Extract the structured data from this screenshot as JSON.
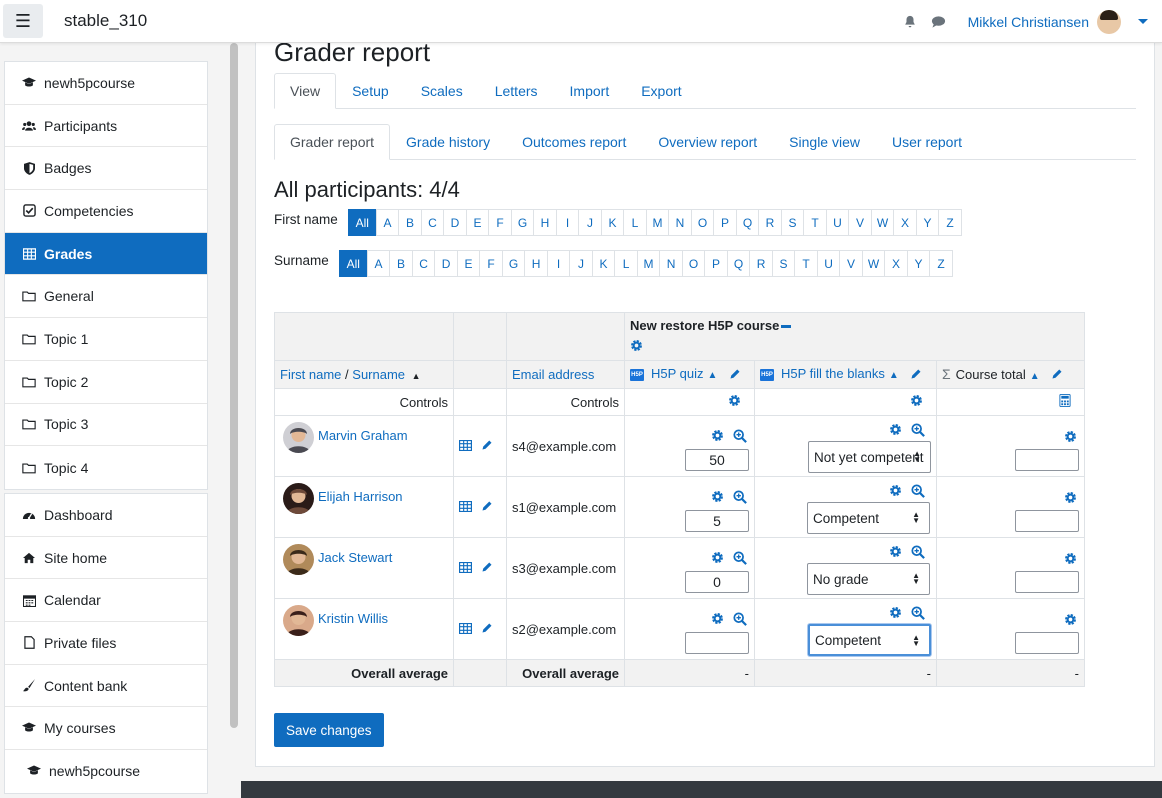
{
  "navbar": {
    "site_name": "stable_310",
    "user_name": "Mikkel Christiansen"
  },
  "sidebar": {
    "course_items": [
      {
        "label": "newh5pcourse",
        "icon": "graduation-cap-icon"
      },
      {
        "label": "Participants",
        "icon": "users-icon"
      },
      {
        "label": "Badges",
        "icon": "shield-icon"
      },
      {
        "label": "Competencies",
        "icon": "check-square-icon"
      },
      {
        "label": "Grades",
        "icon": "table-icon"
      },
      {
        "label": "General",
        "icon": "folder-icon"
      },
      {
        "label": "Topic 1",
        "icon": "folder-icon"
      },
      {
        "label": "Topic 2",
        "icon": "folder-icon"
      },
      {
        "label": "Topic 3",
        "icon": "folder-icon"
      },
      {
        "label": "Topic 4",
        "icon": "folder-icon"
      }
    ],
    "site_items": [
      {
        "label": "Dashboard",
        "icon": "tachometer-icon"
      },
      {
        "label": "Site home",
        "icon": "home-icon"
      },
      {
        "label": "Calendar",
        "icon": "calendar-icon"
      },
      {
        "label": "Private files",
        "icon": "file-icon"
      },
      {
        "label": "Content bank",
        "icon": "paint-brush-icon"
      },
      {
        "label": "My courses",
        "icon": "graduation-cap-icon"
      },
      {
        "label": "newh5pcourse",
        "icon": "graduation-cap-icon"
      }
    ]
  },
  "main": {
    "page_title": "Grader report",
    "tabs_top": [
      "View",
      "Setup",
      "Scales",
      "Letters",
      "Import",
      "Export"
    ],
    "tabs_sub": [
      "Grader report",
      "Grade history",
      "Outcomes report",
      "Overview report",
      "Single view",
      "User report"
    ],
    "participants_title": "All participants: 4/4",
    "first_name_label": "First name",
    "surname_label": "Surname",
    "all_label": "All",
    "letters": [
      "A",
      "B",
      "C",
      "D",
      "E",
      "F",
      "G",
      "H",
      "I",
      "J",
      "K",
      "L",
      "M",
      "N",
      "O",
      "P",
      "Q",
      "R",
      "S",
      "T",
      "U",
      "V",
      "W",
      "X",
      "Y",
      "Z"
    ],
    "save_label": "Save changes"
  },
  "table": {
    "category": "New restore H5P course",
    "col_firstname": "First name",
    "col_sep": "/",
    "col_surname": "Surname",
    "col_email": "Email address",
    "col_quiz": "H5P quiz",
    "col_blanks": "H5P fill the blanks",
    "col_total": "Course total",
    "h5p_badge": "H5P",
    "controls": "Controls",
    "overall_average": "Overall average",
    "avg_dash": "-",
    "rows": [
      {
        "name": "Marvin Graham",
        "email": "s4@example.com",
        "quiz": "50",
        "blanks": "Not yet competent",
        "total": ""
      },
      {
        "name": "Elijah Harrison",
        "email": "s1@example.com",
        "quiz": "5",
        "blanks": "Competent",
        "total": ""
      },
      {
        "name": "Jack Stewart",
        "email": "s3@example.com",
        "quiz": "0",
        "blanks": "No grade",
        "total": ""
      },
      {
        "name": "Kristin Willis",
        "email": "s2@example.com",
        "quiz": "",
        "blanks": "Competent",
        "total": ""
      }
    ]
  },
  "colors": {
    "primary": "#0f6cbf",
    "border": "#dee2e6",
    "header_bg": "#f2f2f2"
  }
}
